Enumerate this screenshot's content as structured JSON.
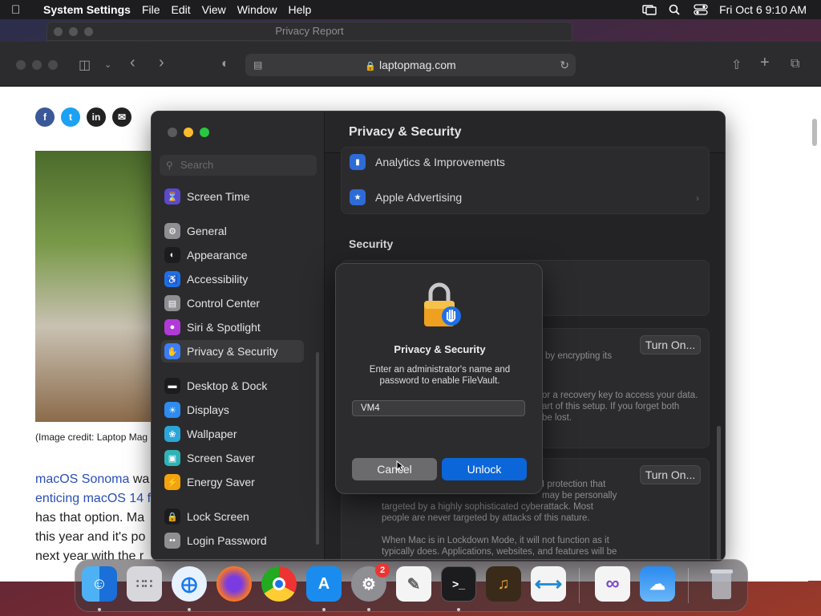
{
  "menubar": {
    "app_name": "System Settings",
    "items": [
      "File",
      "Edit",
      "View",
      "Window",
      "Help"
    ],
    "clock": "Fri Oct 6  9:10 AM"
  },
  "background_window": {
    "title": "Privacy Report"
  },
  "safari": {
    "url": "laptopmag.com",
    "caption": "(Image credit: Laptop Mag",
    "article": {
      "line1_link": "macOS Sonoma",
      "line1_rest": " wa",
      "line2_link": "enticing macOS 14 f",
      "line3": "has that option. Ma",
      "line4": "this year and it's po",
      "line5": "next year with the r"
    }
  },
  "settings": {
    "search_placeholder": "Search",
    "sidebar": [
      {
        "label": "Screen Time",
        "icon": "hourglass-icon",
        "color": "#5b4ac9"
      },
      {
        "label": "General",
        "icon": "gear-icon",
        "color": "#8e8e93"
      },
      {
        "label": "Appearance",
        "icon": "appearance-icon",
        "color": "#1c1c1e"
      },
      {
        "label": "Accessibility",
        "icon": "accessibility-icon",
        "color": "#1f6fe5"
      },
      {
        "label": "Control Center",
        "icon": "control-center-icon",
        "color": "#8e8e93"
      },
      {
        "label": "Siri & Spotlight",
        "icon": "siri-icon",
        "color": "#b03ad8"
      },
      {
        "label": "Privacy & Security",
        "icon": "hand-icon",
        "color": "#3a7ef5"
      },
      {
        "label": "Desktop & Dock",
        "icon": "dock-icon",
        "color": "#1c1c1e"
      },
      {
        "label": "Displays",
        "icon": "displays-icon",
        "color": "#2d8cf0"
      },
      {
        "label": "Wallpaper",
        "icon": "wallpaper-icon",
        "color": "#2ba6d8"
      },
      {
        "label": "Screen Saver",
        "icon": "screen-saver-icon",
        "color": "#2fb3b7"
      },
      {
        "label": "Energy Saver",
        "icon": "energy-icon",
        "color": "#f2a30f"
      },
      {
        "label": "Lock Screen",
        "icon": "lock-icon",
        "color": "#1c1c1e"
      },
      {
        "label": "Login Password",
        "icon": "password-icon",
        "color": "#8e8e93"
      }
    ],
    "pane_title": "Privacy & Security",
    "rows": [
      "Analytics & Improvements",
      "Apple Advertising"
    ],
    "security_heading": "Security",
    "filevault_button": "Turn On...",
    "filevault_text_1": "by encrypting its",
    "filevault_text_2": "or a recovery key to access your data.",
    "filevault_text_3": "art of this setup. If you forget both",
    "filevault_text_4": "be lost.",
    "lockdown_button": "Turn On...",
    "lockdown_text_1": "I protection that",
    "lockdown_text_2": "may be personally",
    "lockdown_text_3": "targeted by a highly sophisticated cyberattack. Most",
    "lockdown_text_4": "people are never targeted by attacks of this nature.",
    "lockdown_text_5": "When Mac is in Lockdown Mode, it will not function as it",
    "lockdown_text_6": "typically does. Applications, websites, and features will be"
  },
  "dialog": {
    "title": "Privacy & Security",
    "message": "Enter an administrator's name and password to enable FileVault.",
    "username": "VM4",
    "cancel_label": "Cancel",
    "unlock_label": "Unlock"
  },
  "dock": {
    "apps": [
      "Finder",
      "Launchpad",
      "Safari",
      "Firefox",
      "Chrome",
      "App Store",
      "System Settings",
      "TextEdit",
      "Terminal",
      "GarageBand",
      "Visual Studio Code",
      "Visual Studio",
      "Weather",
      "Trash"
    ],
    "settings_badge": "2"
  }
}
